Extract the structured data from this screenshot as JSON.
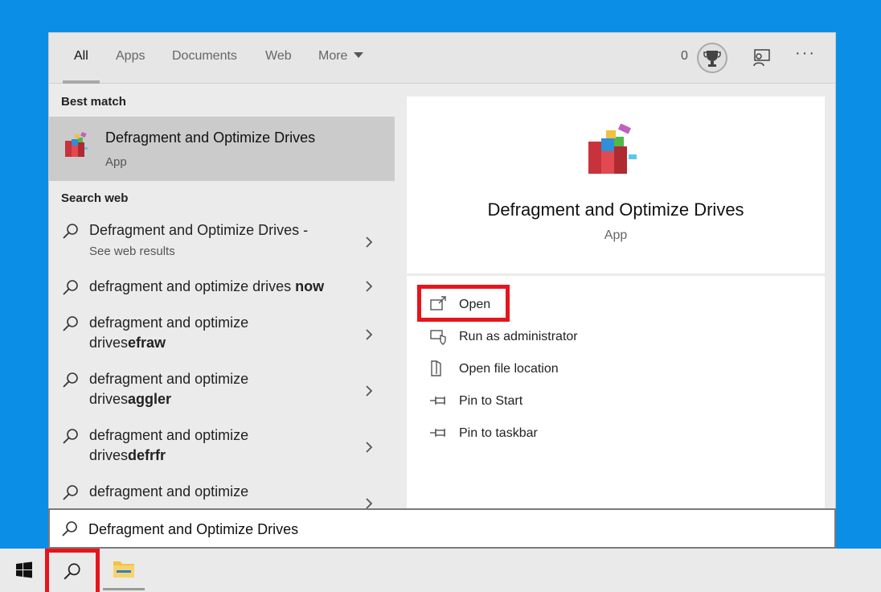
{
  "tabs": [
    {
      "label": "All"
    },
    {
      "label": "Apps"
    },
    {
      "label": "Documents"
    },
    {
      "label": "Web"
    },
    {
      "label": "More"
    }
  ],
  "rewards": {
    "points": "0"
  },
  "best_match": {
    "section_label": "Best match",
    "title": "Defragment and Optimize Drives",
    "subtitle": "App"
  },
  "web": {
    "section_label": "Search web",
    "items": [
      {
        "text": "Defragment and Optimize Drives -",
        "bold": "",
        "sub": "See web results"
      },
      {
        "text": "defragment and optimize drives ",
        "bold": "now",
        "sub": ""
      },
      {
        "text": "defragment and optimize drives",
        "bold": "efraw",
        "sub": ""
      },
      {
        "text": "defragment and optimize drives",
        "bold": "aggler",
        "sub": ""
      },
      {
        "text": "defragment and optimize drives",
        "bold": "defrfr",
        "sub": ""
      },
      {
        "text": "defragment and optimize",
        "bold": "",
        "sub": ""
      }
    ]
  },
  "preview": {
    "title": "Defragment and Optimize Drives",
    "subtitle": "App",
    "actions": [
      {
        "label": "Open",
        "icon": "open-icon"
      },
      {
        "label": "Run as administrator",
        "icon": "shield-icon"
      },
      {
        "label": "Open file location",
        "icon": "file-location-icon"
      },
      {
        "label": "Pin to Start",
        "icon": "pin-icon"
      },
      {
        "label": "Pin to taskbar",
        "icon": "pin-icon"
      }
    ]
  },
  "search": {
    "value": "Defragment and Optimize Drives"
  },
  "colors": {
    "desktop": "#0a8ee6",
    "highlight": "#e8141b",
    "selected_row": "#cbcbcb"
  }
}
